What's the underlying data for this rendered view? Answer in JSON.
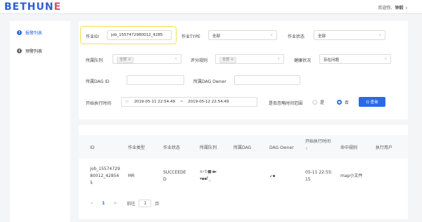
{
  "brand": {
    "logo_main": "BETHUN",
    "logo_accent": "E"
  },
  "topbar": {
    "greeting": "欢迎你,",
    "user": "钟毅",
    "caret": "∨"
  },
  "sidebar": {
    "items": [
      {
        "label": "报警列表",
        "icon": "alert-icon",
        "active": true
      },
      {
        "label": "预警列表",
        "icon": "info-icon",
        "active": false
      }
    ]
  },
  "filters": {
    "job_id": {
      "label": "作业ID",
      "value": "job_1557472980012_4285"
    },
    "job_type": {
      "label": "作业TYPE",
      "value": "全部"
    },
    "job_status": {
      "label": "作业状态",
      "value": "全部"
    },
    "queue": {
      "label": "所属队列",
      "tag": "全部"
    },
    "rule": {
      "label": "评分规则",
      "tag": "全部"
    },
    "health": {
      "label": "健康状况",
      "value": "存在问题"
    },
    "dag_id": {
      "label": "所属DAG ID",
      "value": ""
    },
    "dag_owner": {
      "label": "所属DAG Owner",
      "value": ""
    },
    "start_time": {
      "label": "开始执行时间",
      "from": "2019-05-11 22:54:49",
      "sep": "~",
      "to": "2019-05-12 22:54:49"
    },
    "ignore_time": {
      "label": "是否忽略时间范围",
      "yes": "是",
      "no": "否",
      "selected": "no"
    },
    "query_button": "Q 查询"
  },
  "table": {
    "columns": [
      "ID",
      "作业类型",
      "作业状态",
      "所属队列",
      "所属DAG",
      "DAG Owner",
      "开始执行时间",
      "命中规则",
      "执行用户"
    ],
    "sort_indicator": "⇕",
    "rows": [
      {
        "id": [
          "job_15574729",
          "80012_42854",
          "5"
        ],
        "type": "MR",
        "status": [
          "SUCCEEDE",
          "D"
        ],
        "queue": [
          "x✓t-■ ▪▸",
          "▾▪▪f _"
        ],
        "dag": "",
        "owner": "↙▪",
        "start": [
          "05-11 22:55:",
          "15"
        ],
        "rule": "map小文件",
        "user": ""
      }
    ]
  },
  "pagination": {
    "prev": "<",
    "current": "1",
    "next": ">",
    "goto_label": "前往",
    "goto_value": "1",
    "page_suffix": "页"
  }
}
